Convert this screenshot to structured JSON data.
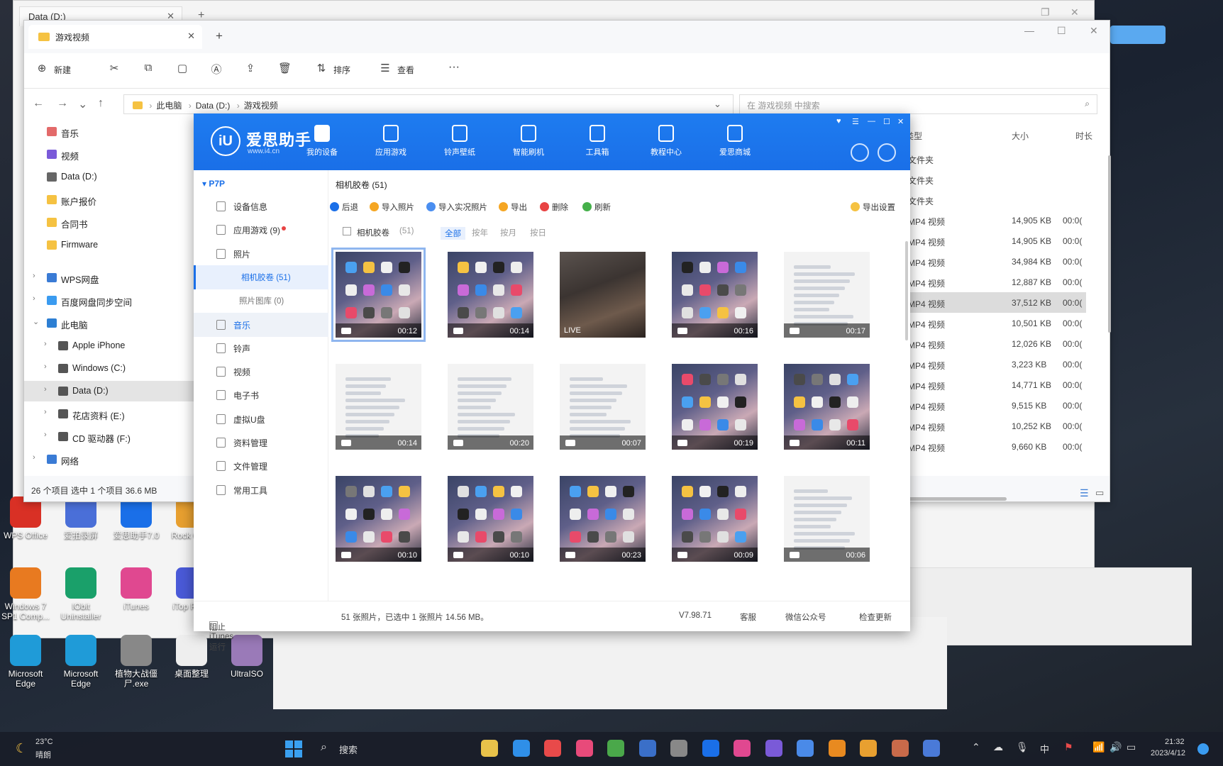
{
  "bg_window": {
    "tab_title": "Data (D:)"
  },
  "explorer": {
    "tab_title": "游戏视频",
    "toolbar": {
      "new": "新建",
      "sort": "排序",
      "view": "查看",
      "more": "···"
    },
    "address": [
      "此电脑",
      "Data (D:)",
      "游戏视频"
    ],
    "search_placeholder": "在 游戏视频 中搜索",
    "side": [
      {
        "label": "音乐",
        "color": "#e36a6a"
      },
      {
        "label": "视频",
        "color": "#7a5ad9"
      },
      {
        "label": "Data (D:)",
        "color": "#666"
      },
      {
        "label": "账户报价",
        "color": "#f5c242"
      },
      {
        "label": "合同书",
        "color": "#f5c242"
      },
      {
        "label": "Firmware",
        "color": "#f5c242"
      },
      {
        "label": "WPS网盘",
        "color": "#3a7bd5"
      },
      {
        "label": "百度网盘同步空间",
        "color": "#3a9bf0"
      },
      {
        "label": "此电脑",
        "color": "#2d7fd3"
      },
      {
        "label": "Apple iPhone",
        "color": "#555"
      },
      {
        "label": "Windows (C:)",
        "color": "#555"
      },
      {
        "label": "Data (D:)",
        "color": "#555"
      },
      {
        "label": "花店资料 (E:)",
        "color": "#555"
      },
      {
        "label": "CD 驱动器 (F:)",
        "color": "#555"
      },
      {
        "label": "网络",
        "color": "#3a7bd5"
      }
    ],
    "status": "26 个项目    选中 1 个项目  36.6 MB",
    "columns": {
      "type": "类型",
      "size": "大小",
      "duration": "时长"
    },
    "rows": [
      {
        "type": "文件夹",
        "size": "",
        "dur": ""
      },
      {
        "type": "文件夹",
        "size": "",
        "dur": ""
      },
      {
        "type": "文件夹",
        "size": "",
        "dur": ""
      },
      {
        "type": "MP4 视频",
        "size": "14,905 KB",
        "dur": "00:0("
      },
      {
        "type": "MP4 视频",
        "size": "14,905 KB",
        "dur": "00:0("
      },
      {
        "type": "MP4 视频",
        "size": "34,984 KB",
        "dur": "00:0("
      },
      {
        "type": "MP4 视频",
        "size": "12,887 KB",
        "dur": "00:0("
      },
      {
        "type": "MP4 视频",
        "size": "37,512 KB",
        "dur": "00:0("
      },
      {
        "type": "MP4 视频",
        "size": "10,501 KB",
        "dur": "00:0("
      },
      {
        "type": "MP4 视频",
        "size": "12,026 KB",
        "dur": "00:0("
      },
      {
        "type": "MP4 视频",
        "size": "3,223 KB",
        "dur": "00:0("
      },
      {
        "type": "MP4 视频",
        "size": "14,771 KB",
        "dur": "00:0("
      },
      {
        "type": "MP4 视频",
        "size": "9,515 KB",
        "dur": "00:0("
      },
      {
        "type": "MP4 视频",
        "size": "10,252 KB",
        "dur": "00:0("
      },
      {
        "type": "MP4 视频",
        "size": "9,660 KB",
        "dur": "00:0("
      }
    ]
  },
  "i4": {
    "logo_text": "爱思助手",
    "logo_url": "www.i4.cn",
    "nav": [
      "我的设备",
      "应用游戏",
      "铃声壁纸",
      "智能刷机",
      "工具箱",
      "教程中心",
      "爱思商城"
    ],
    "p2p": "P7P",
    "side": [
      {
        "label": "设备信息",
        "cls": ""
      },
      {
        "label": "应用游戏 (9)",
        "cls": ""
      },
      {
        "label": "照片",
        "cls": ""
      },
      {
        "label": "相机胶卷 (51)",
        "cls": "sub active"
      },
      {
        "label": "照片图库 (0)",
        "cls": "sub"
      },
      {
        "label": "音乐",
        "cls": "hover"
      },
      {
        "label": "铃声",
        "cls": ""
      },
      {
        "label": "视频",
        "cls": ""
      },
      {
        "label": "电子书",
        "cls": ""
      },
      {
        "label": "虚拟U盘",
        "cls": ""
      },
      {
        "label": "资料管理",
        "cls": ""
      },
      {
        "label": "文件管理",
        "cls": ""
      },
      {
        "label": "常用工具",
        "cls": ""
      }
    ],
    "crumb": "相机胶卷 (51)",
    "actions": [
      {
        "label": "后退",
        "color": "#1a6fe8"
      },
      {
        "label": "导入照片",
        "color": "#f5a623"
      },
      {
        "label": "导入实况照片",
        "color": "#4a8ef0"
      },
      {
        "label": "导出",
        "color": "#f5a623"
      },
      {
        "label": "删除",
        "color": "#e84343"
      },
      {
        "label": "刷新",
        "color": "#45b04a"
      }
    ],
    "export_settings": "导出设置",
    "filter_label": "相机胶卷",
    "filter_count": "(51)",
    "filters": [
      "全部",
      "按年",
      "按月",
      "按日"
    ],
    "tiles": [
      {
        "kind": "home",
        "dur": "00:12",
        "sel": true
      },
      {
        "kind": "home",
        "dur": "00:14"
      },
      {
        "kind": "live",
        "dur": "LIVE"
      },
      {
        "kind": "home",
        "dur": "00:16"
      },
      {
        "kind": "settings",
        "dur": "00:17"
      },
      {
        "kind": "settings",
        "dur": "00:14"
      },
      {
        "kind": "settings",
        "dur": "00:20"
      },
      {
        "kind": "settings",
        "dur": "00:07"
      },
      {
        "kind": "home",
        "dur": "00:19"
      },
      {
        "kind": "home",
        "dur": "00:11"
      },
      {
        "kind": "home",
        "dur": "00:10"
      },
      {
        "kind": "home",
        "dur": "00:10"
      },
      {
        "kind": "home",
        "dur": "00:23"
      },
      {
        "kind": "home",
        "dur": "00:09"
      },
      {
        "kind": "settings",
        "dur": "00:06"
      }
    ],
    "footer": {
      "itunes": "阻止iTunes运行",
      "summary": "51 张照片，已选中 1 张照片 14.56 MB。",
      "version": "V7.98.71",
      "feedback": "客服",
      "wechat": "微信公众号",
      "update": "检查更新"
    }
  },
  "desktop_icons": [
    {
      "label": "WPS Office",
      "color": "#d93025"
    },
    {
      "label": "爱拍录屏",
      "color": "#4a6fd8"
    },
    {
      "label": "爱思助手7.0",
      "color": "#1a6fe8"
    },
    {
      "label": "Rock Gam",
      "color": "#e8a030"
    },
    {
      "label": "Windows 7 SP1 Comp...",
      "color": "#e87a20"
    },
    {
      "label": "IObit Uninstaller",
      "color": "#1aa06a"
    },
    {
      "label": "iTunes",
      "color": "#e04890"
    },
    {
      "label": "iTop Reco",
      "color": "#4a5ad8"
    },
    {
      "label": "Microsoft Edge",
      "color": "#1f9bd8"
    },
    {
      "label": "Microsoft Edge",
      "color": "#1f9bd8"
    },
    {
      "label": "植物大战僵尸.exe",
      "color": "#888"
    },
    {
      "label": "桌面整理",
      "color": "#eee"
    },
    {
      "label": "UltraISO",
      "color": "#9a7ab8"
    }
  ],
  "taskbar": {
    "weather_temp": "23°C",
    "weather_desc": "晴朗",
    "search": "搜索",
    "ime": "中",
    "time": "21:32",
    "date": "2023/4/12",
    "apps": [
      "#e8c24a",
      "#2f8fe8",
      "#e84a4a",
      "#e84a7a",
      "#4aa84a",
      "#3a6fc8",
      "#888",
      "#1a6fe8",
      "#e04890",
      "#7a5ad8",
      "#4a8ae8",
      "#e88a20",
      "#e8a030",
      "#c86a4a",
      "#4a7ad8"
    ]
  }
}
